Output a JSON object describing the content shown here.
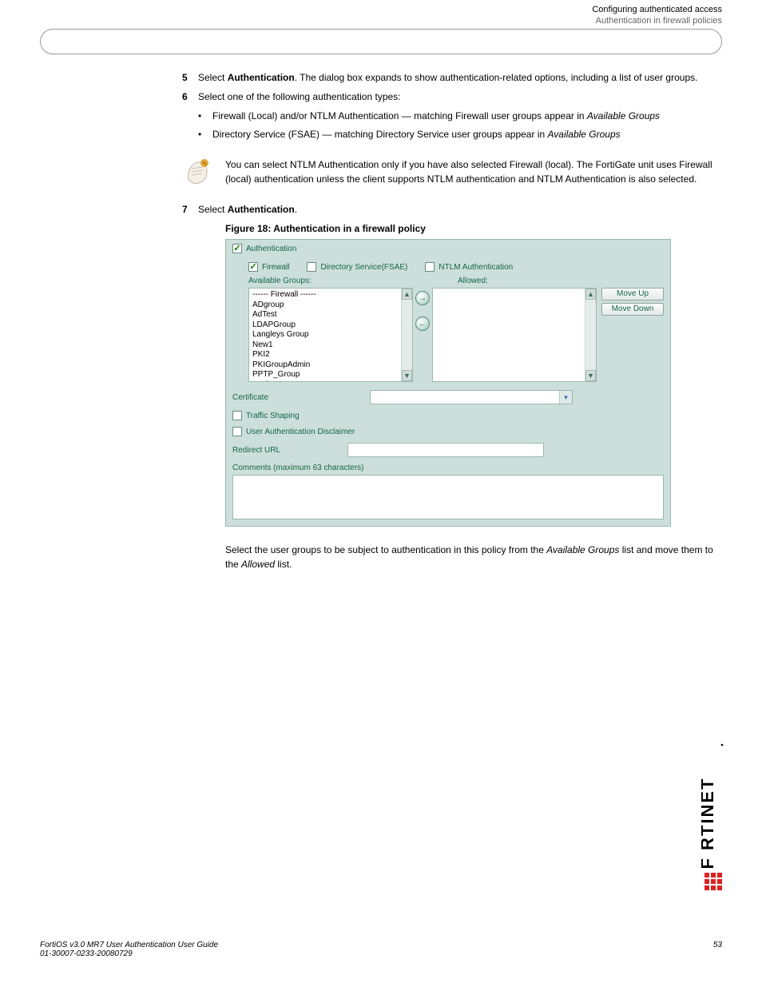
{
  "header": {
    "chapter": "Configuring authenticated access",
    "section": "Authentication in firewall policies"
  },
  "steps": {
    "s5": {
      "num": "5",
      "body_pre": "Select ",
      "bold1": "Authentication",
      "body_post": ". The dialog box expands to show authentication-related options, including a list of user groups."
    },
    "s6": {
      "num": "6",
      "body": "Select one of the following authentication types:"
    },
    "bullets": {
      "b1": {
        "pre": "Firewall (Local) and/or NTLM Authentication ",
        "mid": "— matching Firewall user groups appear in ",
        "it": "Available Groups"
      },
      "b2": {
        "pre": "Directory Service (FSAE) ",
        "mid": "— matching Directory Service user groups appear in ",
        "it": "Available Groups"
      }
    },
    "note": "You can select NTLM Authentication only if you have also selected Firewall (local). The FortiGate unit uses Firewall (local) authentication unless the client supports NTLM authentication and NTLM Authentication is also selected.",
    "s7": {
      "num": "7",
      "pre": "Select ",
      "bold": "Authentication",
      "post": "."
    },
    "figcap": "Figure 18: Authentication in a firewall policy",
    "post": {
      "pre": "Select the user groups to be subject to authentication in this policy from the ",
      "it1": "Available Groups",
      "mid": " list and move them to the ",
      "it2": "Allowed",
      "end": " list."
    }
  },
  "ui": {
    "auth_label": "Authentication",
    "firewall": "Firewall",
    "dirserv": "Directory Service(FSAE)",
    "ntlm": "NTLM Authentication",
    "avail_label": "Available Groups:",
    "allowed_label": "Allowed:",
    "move_up": "Move Up",
    "move_down": "Move Down",
    "groups": [
      "------ Firewall ------",
      "ADgroup",
      "AdTest",
      "LDAPGroup",
      "Langleys Group",
      "New1",
      "PKI2",
      "PKIGroupAdmin",
      "PPTP_Group",
      "RadiusGroup"
    ],
    "cert_label": "Certificate",
    "traffic_label": "Traffic Shaping",
    "disclaimer_label": "User Authentication Disclaimer",
    "redirect_label": "Redirect URL",
    "comments_label": "Comments (maximum 63 characters)"
  },
  "footer": {
    "left": "FortiOS v3.0 MR7 User Authentication User Guide",
    "right_top": "53",
    "right_bot": "01-30007-0233-20080729"
  }
}
